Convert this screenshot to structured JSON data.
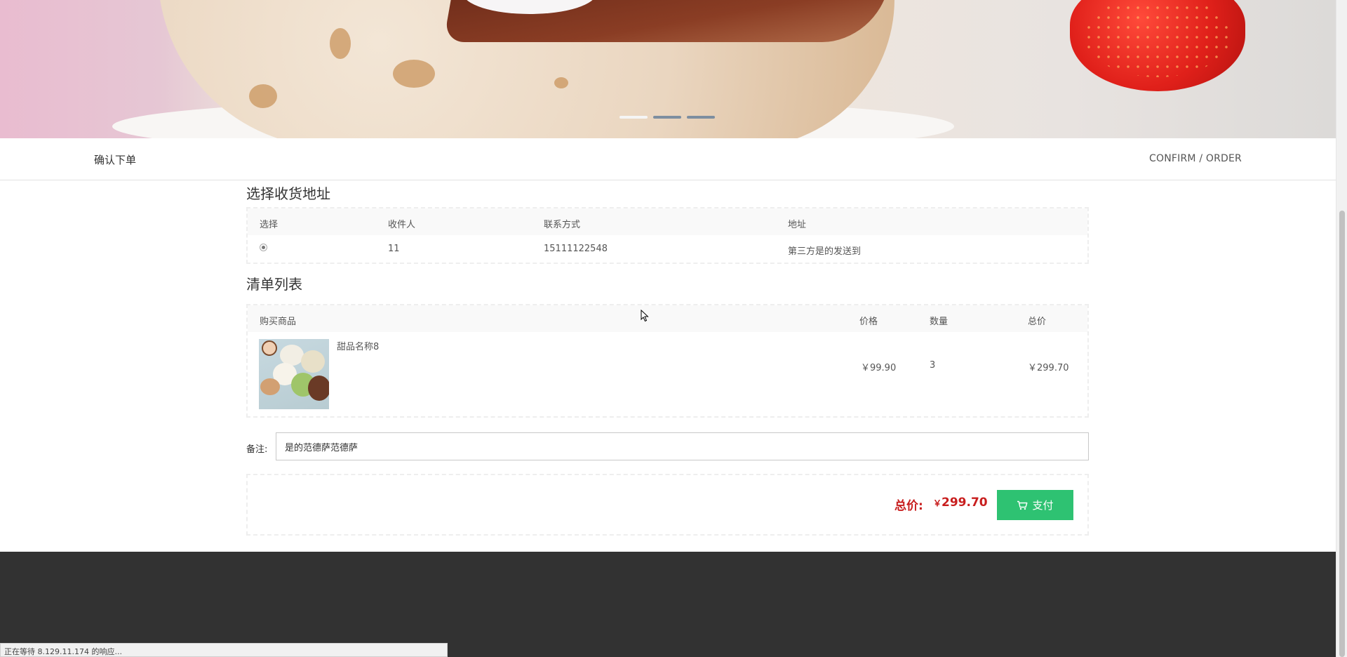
{
  "banner": {
    "slide_count": 3,
    "active_slide": 1,
    "colors": {
      "strawberry": "#e0201a",
      "cocoa": "#6b2a19",
      "pink_bg": "#e9bcd0"
    }
  },
  "header": {
    "title": "确认下单",
    "subtitle_en": "CONFIRM / ORDER"
  },
  "address": {
    "section_title": "选择收货地址",
    "columns": [
      "选择",
      "收件人",
      "联系方式",
      "地址"
    ],
    "rows": [
      {
        "selected": true,
        "recipient": "11",
        "phone": "15111122548",
        "address": "第三方是的发送到"
      }
    ]
  },
  "order_list": {
    "section_title": "清单列表",
    "columns": [
      "购买商品",
      "价格",
      "数量",
      "总价"
    ],
    "items": [
      {
        "name": "甜品名称8",
        "price": "￥99.90",
        "quantity": "3",
        "total": "￥299.70",
        "thumb_icon": "mochi-dessert-photo"
      }
    ]
  },
  "remark": {
    "label": "备注:",
    "value": "是的范德萨范德萨"
  },
  "summary": {
    "total_label": "总价:",
    "total_currency": "￥",
    "total_amount": "299.70",
    "pay_label": "支付",
    "pay_icon": "cart-icon",
    "accent_color": "#2ec272",
    "price_color": "#c81e1e"
  },
  "status_bar": {
    "text": "正在等待 8.129.11.174 的响应..."
  }
}
